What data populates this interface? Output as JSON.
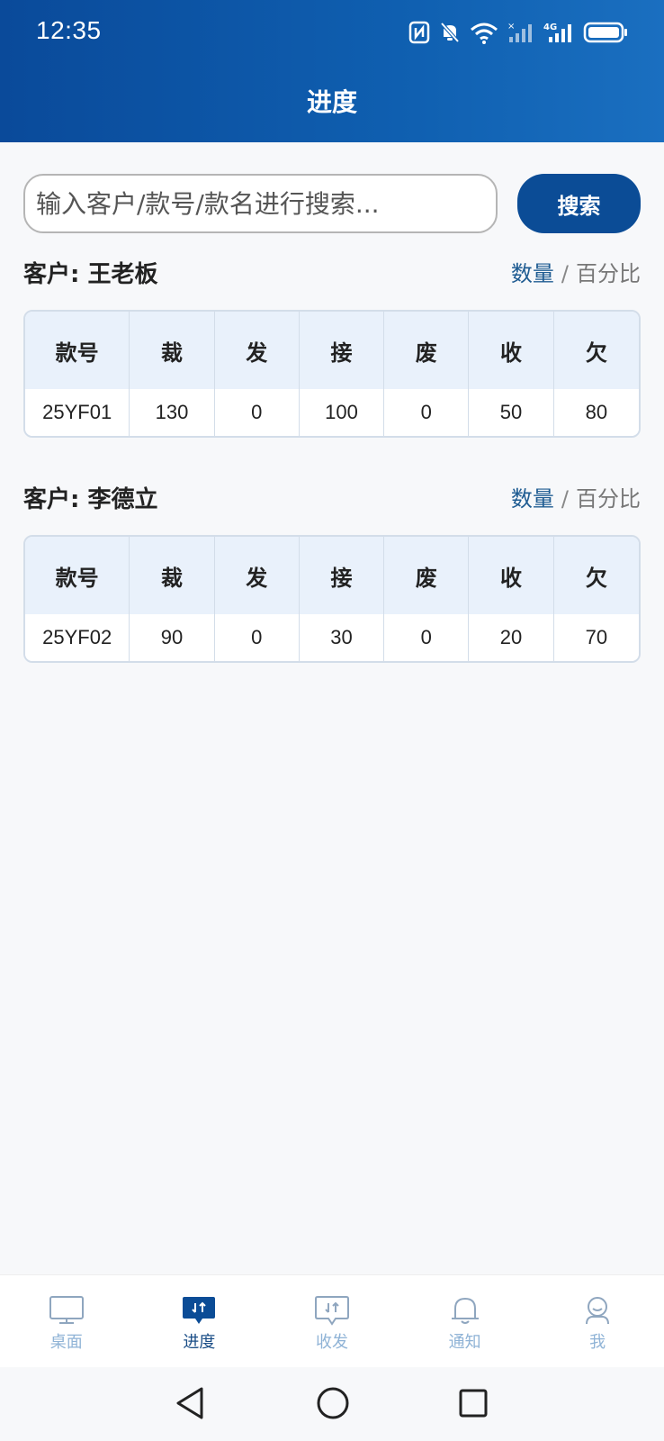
{
  "status_bar": {
    "time": "12:35",
    "network_label": "4G"
  },
  "header": {
    "title": "进度"
  },
  "search": {
    "placeholder": "输入客户/款号/款名进行搜索...",
    "value": "",
    "button_label": "搜索"
  },
  "mode_toggle": {
    "quantity_label": "数量",
    "separator": "/",
    "percent_label": "百分比"
  },
  "customers": [
    {
      "title": "客户: 王老板",
      "columns": [
        "款号",
        "裁",
        "发",
        "接",
        "废",
        "收",
        "欠"
      ],
      "rows": [
        [
          "25YF01",
          "130",
          "0",
          "100",
          "0",
          "50",
          "80"
        ]
      ]
    },
    {
      "title": "客户: 李德立",
      "columns": [
        "款号",
        "裁",
        "发",
        "接",
        "废",
        "收",
        "欠"
      ],
      "rows": [
        [
          "25YF02",
          "90",
          "0",
          "30",
          "0",
          "20",
          "70"
        ]
      ]
    }
  ],
  "bottom_nav": {
    "items": [
      {
        "label": "桌面",
        "icon": "desktop-icon"
      },
      {
        "label": "进度",
        "icon": "progress-icon"
      },
      {
        "label": "收发",
        "icon": "transfer-icon"
      },
      {
        "label": "通知",
        "icon": "bell-icon"
      },
      {
        "label": "我",
        "icon": "user-icon"
      }
    ]
  },
  "colors": {
    "primary": "#0b4c96",
    "accent_text": "#1f5c92",
    "nav_inactive": "#8fb3d6"
  }
}
